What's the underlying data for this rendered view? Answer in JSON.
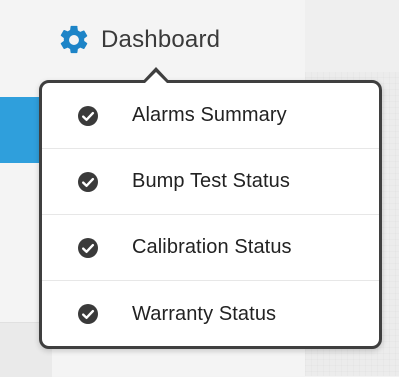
{
  "header": {
    "title": "Dashboard",
    "icon": "gear-icon"
  },
  "menu": {
    "items": [
      {
        "label": "Alarms Summary",
        "icon": "check-circle-icon",
        "checked": true
      },
      {
        "label": "Bump Test Status",
        "icon": "check-circle-icon",
        "checked": true
      },
      {
        "label": "Calibration Status",
        "icon": "check-circle-icon",
        "checked": true
      },
      {
        "label": "Warranty Status",
        "icon": "check-circle-icon",
        "checked": true
      }
    ]
  },
  "colors": {
    "accent_blue": "#2f9fdc",
    "gear_blue": "#1d84c7",
    "dropdown_border": "#3f3f3f",
    "check_fill": "#3a3a3a"
  }
}
